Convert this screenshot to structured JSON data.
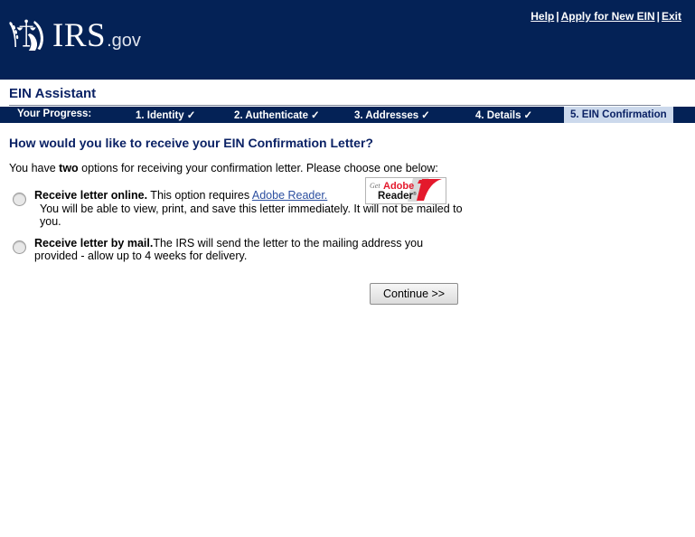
{
  "header": {
    "logo": {
      "mark": "irs-eagle-scales-icon",
      "primary": "IRS",
      "suffix": ".gov"
    },
    "links": [
      {
        "label": "Help",
        "name": "help-link"
      },
      {
        "label": "Apply for New EIN",
        "name": "apply-new-ein-link"
      },
      {
        "label": "Exit",
        "name": "exit-link"
      }
    ],
    "separator": "|"
  },
  "assistant": {
    "title": "EIN Assistant"
  },
  "progress": {
    "label": "Your Progress:",
    "check_glyph": "✓",
    "steps": [
      {
        "label": "1. Identity",
        "complete": true
      },
      {
        "label": "2. Authenticate",
        "complete": true
      },
      {
        "label": "3. Addresses",
        "complete": true
      },
      {
        "label": "4. Details",
        "complete": true
      },
      {
        "label": "5. EIN Confirmation",
        "complete": false,
        "current": true
      }
    ]
  },
  "main": {
    "heading": "How would you like to receive your EIN Confirmation Letter?",
    "intro_before": "You have ",
    "intro_emphasis": "two",
    "intro_after": " options for receiving your confirmation letter. Please choose one below:",
    "options": [
      {
        "name": "receive-online",
        "lead": "Receive letter online.",
        "body": " This option requires ",
        "link": "Adobe Reader.",
        "detail": "You will be able to view, print, and save this letter immediately. It will not be mailed to you."
      },
      {
        "name": "receive-by-mail",
        "lead": "Receive letter by mail.",
        "body": "The IRS will send the letter to the mailing address you provided - allow up to 4 weeks for delivery.",
        "link": "",
        "detail": ""
      }
    ],
    "adobe_badge": {
      "get": "Get",
      "adobe": "Adobe",
      "reader": "Reader",
      "trademark": "®"
    },
    "continue_label": "Continue >>"
  },
  "colors": {
    "navy": "#042256",
    "active_tab": "#ccd9ec",
    "heading": "#0b2265",
    "link": "#2c4fa0",
    "adobe_red": "#e4192c"
  }
}
